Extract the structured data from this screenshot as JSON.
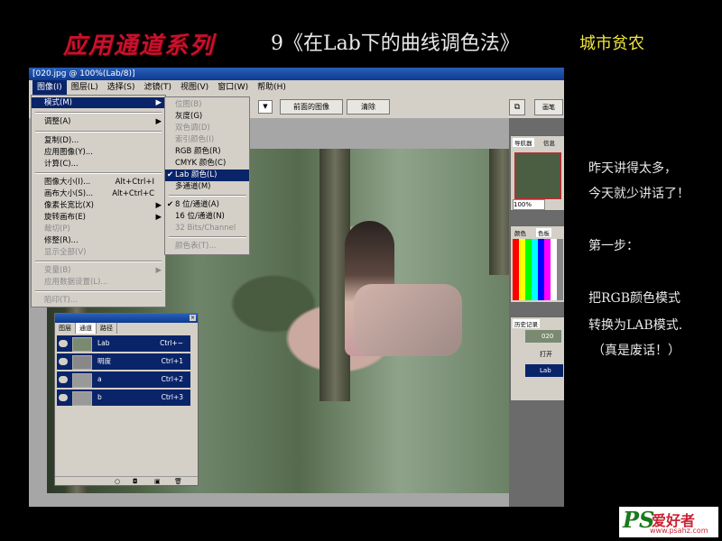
{
  "header": {
    "series": "应用通道系列",
    "title": "9《在Lab下的曲线调色法》",
    "author": "城市贫农"
  },
  "window": {
    "title": "[020.jpg @ 100%(Lab/8)]"
  },
  "menubar": [
    "图像(I)",
    "图层(L)",
    "选择(S)",
    "滤镜(T)",
    "视图(V)",
    "窗口(W)",
    "帮助(H)"
  ],
  "toolbar": {
    "btn_prev": "前面的图像",
    "btn_clear": "清除",
    "tab_brushes": "画笔"
  },
  "image_menu": [
    {
      "label": "模式(M)",
      "shortcut": "",
      "arrow": "▶",
      "highlight": true,
      "disabled": false
    },
    {
      "label": "调整(A)",
      "shortcut": "",
      "arrow": "▶",
      "highlight": false,
      "disabled": false
    },
    {
      "label": "复制(D)...",
      "shortcut": "",
      "arrow": "",
      "highlight": false,
      "disabled": false
    },
    {
      "label": "应用图像(Y)...",
      "shortcut": "",
      "arrow": "",
      "highlight": false,
      "disabled": false
    },
    {
      "label": "计算(C)...",
      "shortcut": "",
      "arrow": "",
      "highlight": false,
      "disabled": false
    },
    {
      "label": "图像大小(I)...",
      "shortcut": "Alt+Ctrl+I",
      "arrow": "",
      "highlight": false,
      "disabled": false
    },
    {
      "label": "画布大小(S)...",
      "shortcut": "Alt+Ctrl+C",
      "arrow": "",
      "highlight": false,
      "disabled": false
    },
    {
      "label": "像素长宽比(X)",
      "shortcut": "",
      "arrow": "▶",
      "highlight": false,
      "disabled": false
    },
    {
      "label": "旋转画布(E)",
      "shortcut": "",
      "arrow": "▶",
      "highlight": false,
      "disabled": false
    },
    {
      "label": "裁切(P)",
      "shortcut": "",
      "arrow": "",
      "highlight": false,
      "disabled": true
    },
    {
      "label": "修整(R)...",
      "shortcut": "",
      "arrow": "",
      "highlight": false,
      "disabled": false
    },
    {
      "label": "显示全部(V)",
      "shortcut": "",
      "arrow": "",
      "highlight": false,
      "disabled": true
    },
    {
      "label": "变量(B)",
      "shortcut": "",
      "arrow": "▶",
      "highlight": false,
      "disabled": true
    },
    {
      "label": "应用数据设置(L)...",
      "shortcut": "",
      "arrow": "",
      "highlight": false,
      "disabled": true
    },
    {
      "label": "陷印(T)...",
      "shortcut": "",
      "arrow": "",
      "highlight": false,
      "disabled": true
    }
  ],
  "mode_submenu": [
    {
      "label": "位图(B)",
      "check": "",
      "highlight": false,
      "disabled": true
    },
    {
      "label": "灰度(G)",
      "check": "",
      "highlight": false,
      "disabled": false
    },
    {
      "label": "双色调(D)",
      "check": "",
      "highlight": false,
      "disabled": true
    },
    {
      "label": "索引颜色(I)",
      "check": "",
      "highlight": false,
      "disabled": true
    },
    {
      "label": "RGB 颜色(R)",
      "check": "",
      "highlight": false,
      "disabled": false
    },
    {
      "label": "CMYK 颜色(C)",
      "check": "",
      "highlight": false,
      "disabled": false
    },
    {
      "label": "Lab 颜色(L)",
      "check": "✔",
      "highlight": true,
      "disabled": false
    },
    {
      "label": "多通道(M)",
      "check": "",
      "highlight": false,
      "disabled": false
    },
    {
      "label": "8 位/通道(A)",
      "check": "✔",
      "highlight": false,
      "disabled": false
    },
    {
      "label": "16 位/通道(N)",
      "check": "",
      "highlight": false,
      "disabled": false
    },
    {
      "label": "32 Bits/Channel",
      "check": "",
      "highlight": false,
      "disabled": true
    },
    {
      "label": "颜色表(T)...",
      "check": "",
      "highlight": false,
      "disabled": true
    }
  ],
  "channels_panel": {
    "tabs": [
      "图层",
      "通道",
      "路径"
    ],
    "active_tab": 1,
    "rows": [
      {
        "name": "Lab",
        "shortcut": "Ctrl+~"
      },
      {
        "name": "明度",
        "shortcut": "Ctrl+1"
      },
      {
        "name": "a",
        "shortcut": "Ctrl+2"
      },
      {
        "name": "b",
        "shortcut": "Ctrl+3"
      }
    ]
  },
  "right_panels": {
    "navigator_tab": "导航器",
    "navigator_tab2": "信息",
    "zoom": "100%",
    "color_tab1": "颜色",
    "color_tab2": "色板",
    "history_tab": "历史记录",
    "history_item1": "020",
    "history_item2": "打开",
    "history_item3": "Lab"
  },
  "notes": [
    "昨天讲得太多，",
    "今天就少讲话了！",
    "第一步：",
    "把RGB颜色模式",
    "转换为LAB模式.",
    "（真是废话！）"
  ],
  "logo": {
    "ps": "PS",
    "cn": "爱好者",
    "url": "www.psahz.com"
  }
}
